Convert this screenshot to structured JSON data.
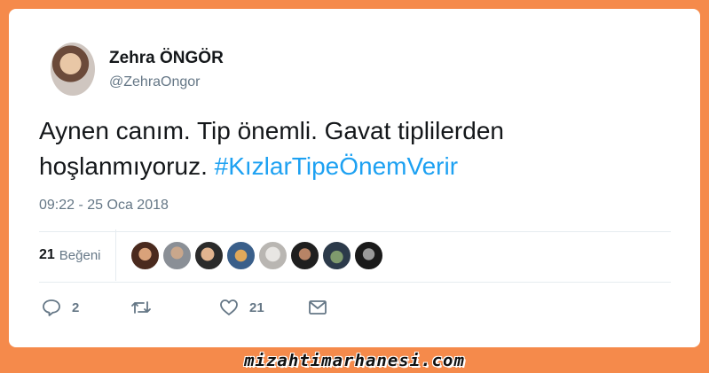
{
  "user": {
    "display_name": "Zehra ÖNGÖR",
    "handle": "@ZehraOngor"
  },
  "tweet": {
    "text": "Aynen canım. Tip önemli. Gavat tiplilerden hoşlanmıyoruz.",
    "hashtag": "#KızlarTipeÖnemVerir",
    "timestamp": "09:22 - 25 Oca 2018"
  },
  "likes": {
    "count": "21",
    "label": "Beğeni",
    "liker_avatar_count": 8
  },
  "actions": {
    "reply_count": "2",
    "retweet_count": "",
    "like_count": "21"
  },
  "watermark": "mizahtimarhanesi.com",
  "colors": {
    "background": "#f58a4b",
    "hashtag": "#1da1f2",
    "muted": "#657786"
  }
}
